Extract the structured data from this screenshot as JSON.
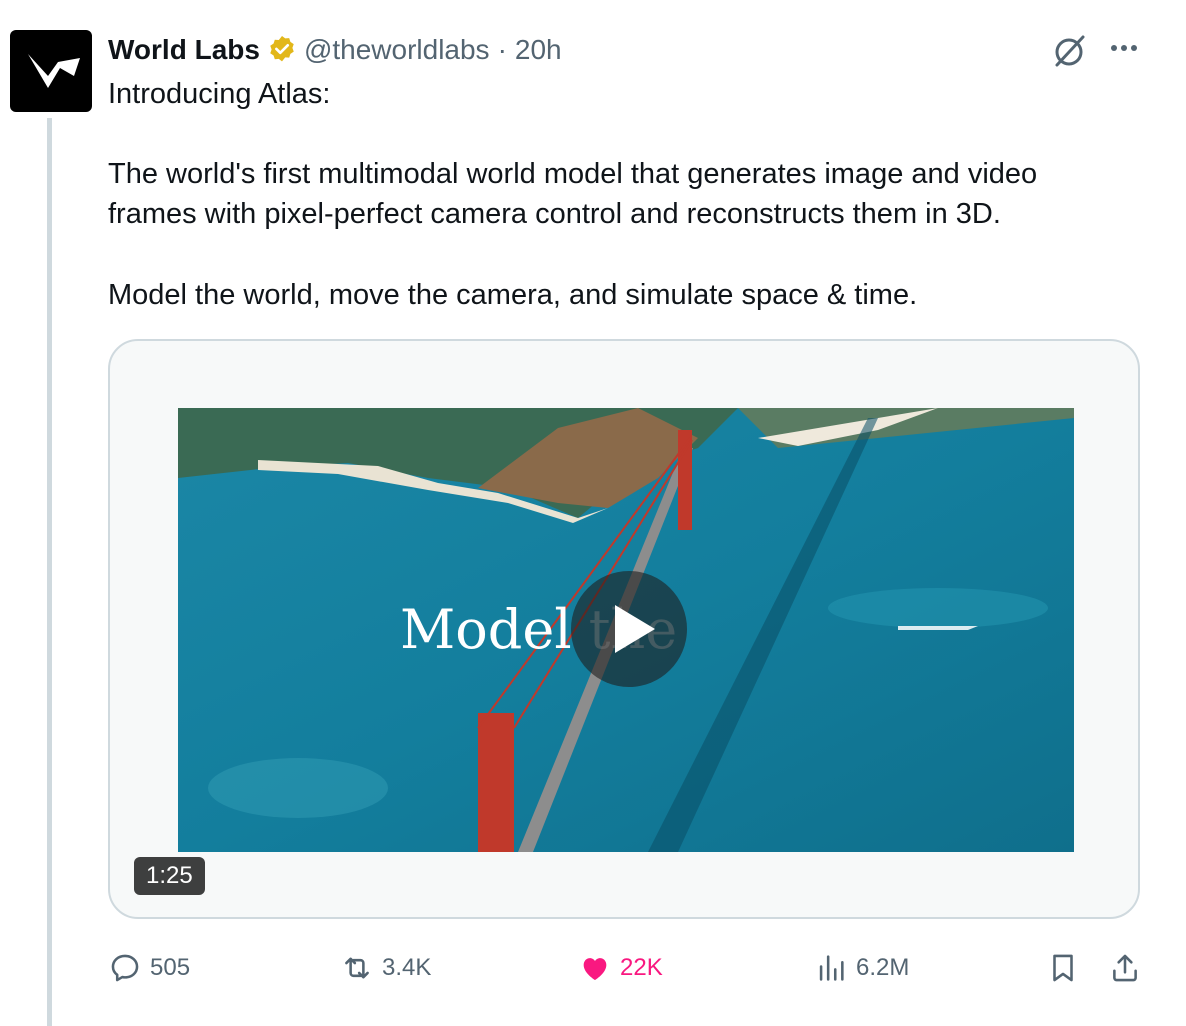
{
  "author": {
    "name": "World Labs",
    "handle": "@theworldlabs",
    "separator": "·",
    "time": "20h",
    "verified": true,
    "avatar_icon": "world-labs-logo"
  },
  "header_icons": {
    "grok": "grok-icon",
    "more": "more-icon"
  },
  "tweet": {
    "line1": "Introducing Atlas:",
    "line2": "The world's first multimodal world model that generates image and video",
    "line3": "frames with pixel-perfect camera control and reconstructs them in 3D.",
    "line4": "Model the world, move the camera, and simulate space & time."
  },
  "video": {
    "overlay_main": "Model ",
    "overlay_faded": "the",
    "duration": "1:25"
  },
  "actions": {
    "replies": "505",
    "reposts": "3.4K",
    "likes": "22K",
    "views": "6.2M"
  },
  "colors": {
    "like": "#f91880",
    "muted": "#536471",
    "border": "#cfd9de",
    "verified": "#e2b719"
  }
}
